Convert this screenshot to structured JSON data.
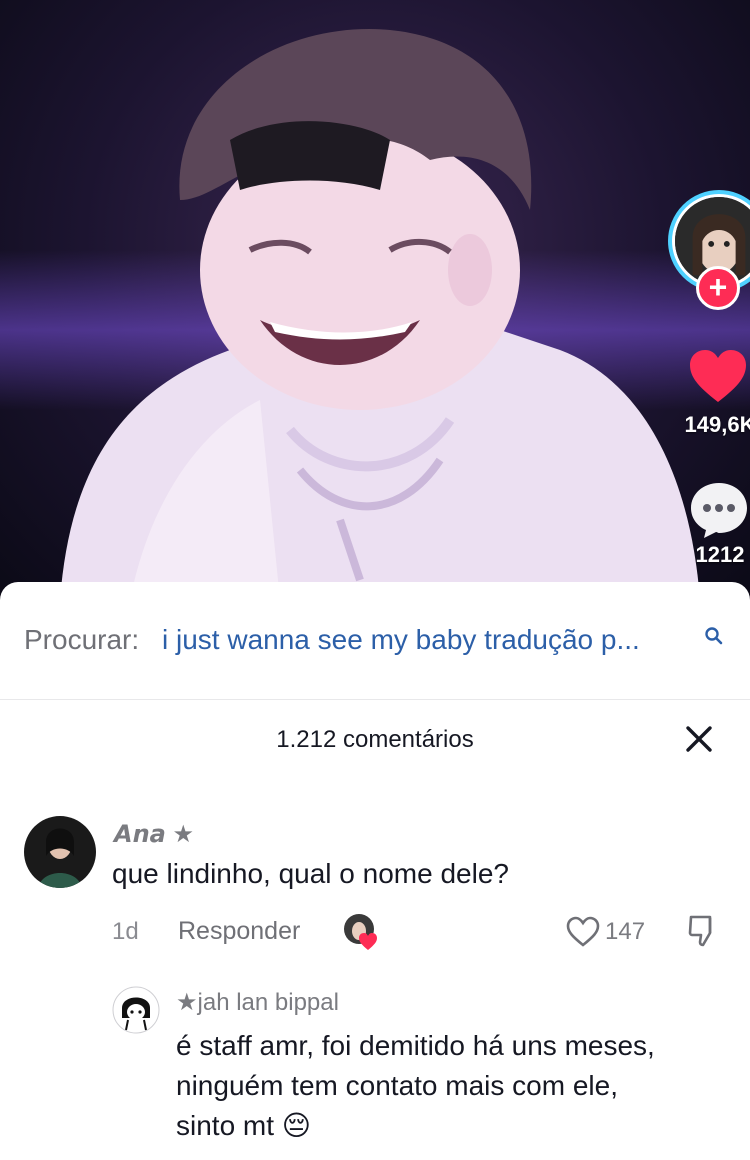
{
  "video": {
    "creator_avatar": "creator-avatar",
    "follow_label": "+",
    "like_count": "149,6K",
    "comment_count": "1212",
    "colors": {
      "follow": "#fe2c55",
      "like": "#fe2c55",
      "avatar_ring": "#4fd1ff"
    }
  },
  "search": {
    "label": "Procurar:",
    "query": "i just wanna see my baby tradução p...",
    "icon": "search-icon"
  },
  "comments_header": {
    "title": "1.212 comentários",
    "close_icon": "close-icon"
  },
  "comments": [
    {
      "user": "𝘼𝙣𝙖 ★",
      "text": "que lindinho, qual o nome dele?",
      "age": "1d",
      "reply_label": "Responder",
      "likes": "147"
    },
    {
      "user": "★jah lan bippal",
      "text_lines": [
        "é staff amr, foi demitido há uns meses,",
        "ninguém tem contato mais com ele,",
        "sinto mt 😔"
      ]
    }
  ]
}
